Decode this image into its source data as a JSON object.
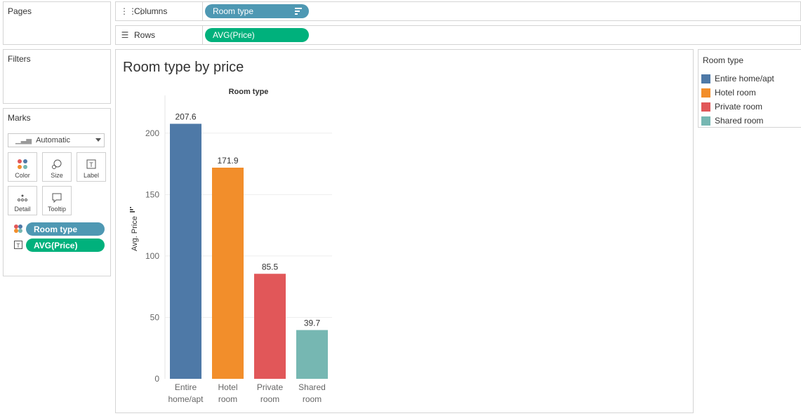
{
  "pages": {
    "title": "Pages"
  },
  "shelves": {
    "columns": {
      "label": "Columns",
      "pill": "Room type"
    },
    "rows": {
      "label": "Rows",
      "pill": "AVG(Price)"
    }
  },
  "filters": {
    "title": "Filters"
  },
  "marks": {
    "title": "Marks",
    "type": "Automatic",
    "buttons": {
      "color": "Color",
      "size": "Size",
      "label": "Label",
      "detail": "Detail",
      "tooltip": "Tooltip"
    },
    "cards": {
      "color_field": "Room type",
      "label_field": "AVG(Price)"
    }
  },
  "legend": {
    "title": "Room type",
    "items": [
      {
        "label": "Entire home/apt",
        "color": "#4e79a7"
      },
      {
        "label": "Hotel room",
        "color": "#f28e2b"
      },
      {
        "label": "Private room",
        "color": "#e15759"
      },
      {
        "label": "Shared room",
        "color": "#76b7b2"
      }
    ]
  },
  "chart_data": {
    "type": "bar",
    "title": "Room type by price",
    "xlabel": "Room type",
    "ylabel": "Avg. Price",
    "categories": [
      [
        "Entire",
        "home/apt"
      ],
      [
        "Hotel",
        "room"
      ],
      [
        "Private",
        "room"
      ],
      [
        "Shared",
        "room"
      ]
    ],
    "values": [
      207.6,
      171.9,
      85.5,
      39.7
    ],
    "value_labels": [
      "207.6",
      "171.9",
      "85.5",
      "39.7"
    ],
    "colors": [
      "#4e79a7",
      "#f28e2b",
      "#e15759",
      "#76b7b2"
    ],
    "ylim": [
      0,
      225
    ],
    "yticks": [
      0,
      50,
      100,
      150,
      200
    ],
    "grid": true
  }
}
